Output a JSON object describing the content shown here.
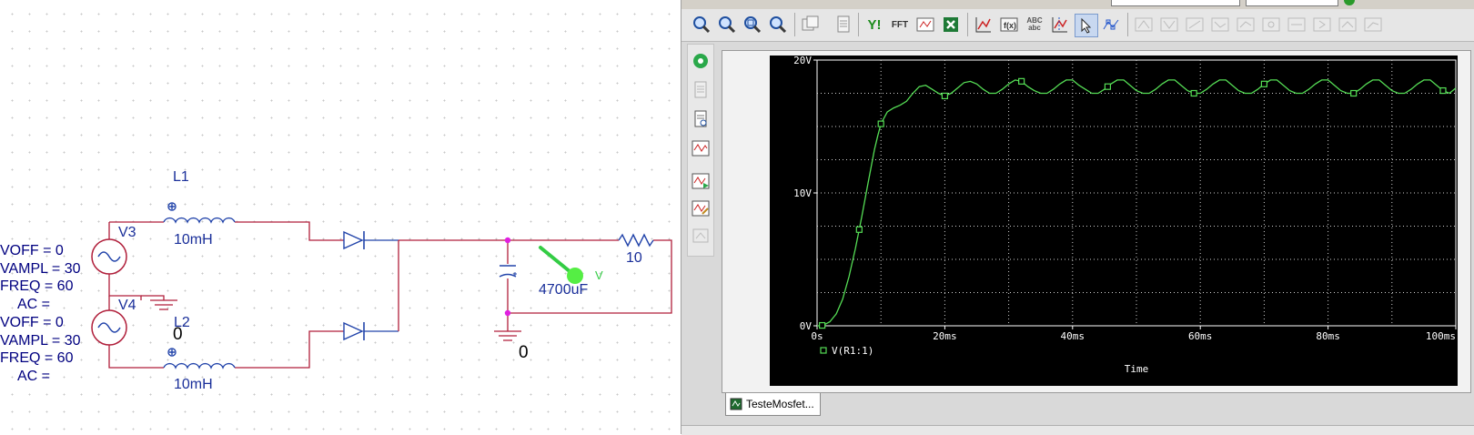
{
  "schematic": {
    "source_top": {
      "name": "V3",
      "params": [
        "VOFF = 0",
        "VAMPL = 30",
        "FREQ = 60",
        "AC ="
      ]
    },
    "source_bottom": {
      "name": "V4",
      "params": [
        "VOFF = 0",
        "VAMPL = 30",
        "FREQ = 60",
        "AC ="
      ]
    },
    "inductor_top": {
      "name": "L1",
      "value": "10mH"
    },
    "inductor_bottom": {
      "name": "L2",
      "value": "10mH"
    },
    "capacitor": {
      "value": "4700uF"
    },
    "resistor": {
      "value": "10"
    },
    "ground_labels": [
      "0",
      "0"
    ],
    "probe_marker": "V"
  },
  "probe": {
    "toolbar": {
      "buttons": [
        "zoom-in-icon",
        "zoom-out-icon",
        "zoom-area-icon",
        "zoom-fit-icon",
        "copy-icon",
        "page-icon",
        "y-axis-icon",
        "fft-icon",
        "performance-icon",
        "excel-icon",
        "add-trace-icon",
        "eval-measurement-icon",
        "text-label-icon",
        "toggle-cursor-icon",
        "select-icon",
        "mark-data-points-icon"
      ],
      "button_text": {
        "y_axis": "Y!",
        "fft": "FFT",
        "abc": "ABC abc"
      }
    },
    "document_tab": "TesteMosfet...",
    "accent_color": "#55dd55"
  },
  "chart_data": {
    "type": "line",
    "title": "",
    "xlabel": "Time",
    "ylabel": "",
    "x_unit": "ms",
    "y_unit": "V",
    "xlim": [
      0,
      100
    ],
    "ylim": [
      0,
      20
    ],
    "x_ticks": [
      0,
      20,
      40,
      60,
      80,
      100
    ],
    "x_tick_labels": [
      "0s",
      "20ms",
      "40ms",
      "60ms",
      "80ms",
      "100ms"
    ],
    "y_ticks": [
      0,
      10,
      20
    ],
    "y_tick_labels": [
      "0V",
      "10V",
      "20V"
    ],
    "grid": true,
    "legend_position": "bottom-left",
    "series": [
      {
        "name": "V(R1:1)",
        "color": "#55dd55",
        "marker": "square",
        "x": [
          0,
          0.5,
          1,
          2,
          3,
          4,
          5,
          6,
          7,
          8,
          9,
          9.5,
          10,
          11,
          12,
          13,
          14,
          15,
          16,
          17,
          18,
          19,
          20,
          21,
          22,
          23,
          24,
          25,
          26,
          27,
          28,
          29,
          30,
          31,
          32,
          33,
          34,
          35,
          36,
          37,
          38,
          39,
          40,
          41,
          42,
          43,
          44,
          45,
          46,
          47,
          48,
          49,
          50,
          51,
          52,
          53,
          54,
          55,
          56,
          57,
          58,
          59,
          60,
          61,
          62,
          63,
          64,
          65,
          66,
          67,
          68,
          69,
          70,
          71,
          72,
          73,
          74,
          75,
          76,
          77,
          78,
          79,
          80,
          81,
          82,
          83,
          84,
          85,
          86,
          87,
          88,
          89,
          90,
          91,
          92,
          93,
          94,
          95,
          96,
          97,
          98,
          99,
          100
        ],
        "y": [
          0,
          0,
          0.05,
          0.3,
          0.9,
          2.0,
          3.7,
          5.8,
          8.2,
          10.8,
          13.3,
          14.3,
          15.2,
          16.1,
          16.4,
          16.6,
          16.9,
          17.5,
          18.0,
          18.1,
          17.8,
          17.5,
          17.3,
          17.5,
          17.9,
          18.3,
          18.4,
          18.2,
          17.8,
          17.5,
          17.5,
          17.8,
          18.2,
          18.5,
          18.4,
          18.0,
          17.7,
          17.5,
          17.5,
          17.8,
          18.2,
          18.5,
          18.5,
          18.1,
          17.8,
          17.5,
          17.5,
          17.8,
          18.2,
          18.5,
          18.5,
          18.1,
          17.7,
          17.5,
          17.5,
          17.8,
          18.2,
          18.5,
          18.5,
          18.1,
          17.7,
          17.5,
          17.5,
          17.8,
          18.2,
          18.5,
          18.5,
          18.1,
          17.7,
          17.5,
          17.5,
          17.8,
          18.2,
          18.5,
          18.5,
          18.1,
          17.7,
          17.5,
          17.5,
          17.8,
          18.2,
          18.5,
          18.5,
          18.1,
          17.7,
          17.5,
          17.5,
          17.8,
          18.2,
          18.5,
          18.5,
          18.1,
          17.7,
          17.5,
          17.5,
          17.8,
          18.2,
          18.5,
          18.5,
          18.1,
          17.7,
          17.5,
          17.9
        ]
      }
    ],
    "marker_x": [
      0.8,
      6.6,
      10.0,
      20.0,
      32.0,
      45.5,
      59.0,
      70.0,
      84.0,
      98.0
    ]
  }
}
